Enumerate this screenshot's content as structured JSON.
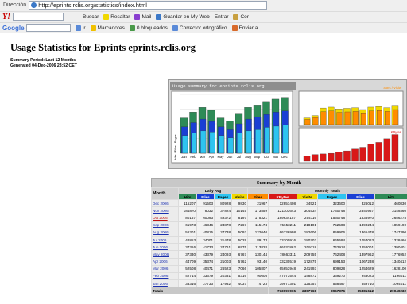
{
  "browser": {
    "address_label": "Dirección",
    "url": "http://eprints.rclis.org/statistics/index.html",
    "yahoo_logo": "Y!",
    "toolbar_items": [
      "Buscar",
      "Resaltar",
      "Mail",
      "Guardar en My Web",
      "Entrar",
      "Cor"
    ],
    "google_logo": "Google",
    "google_items": [
      "Ir",
      "Marcadores",
      "0 bloqueados",
      "Corrector ortográfico",
      "Enviar a"
    ]
  },
  "page": {
    "title": "Usage Statistics for Eprints eprints.rclis.org",
    "summary_period": "Summary Period: Last 12 Months",
    "generated": "Generated 04-Dec-2006 23:52 CET"
  },
  "chart_data": {
    "type": "bar",
    "title": "Usage summary for eprints.rclis.org",
    "right_legend": [
      "Sites",
      "Visits",
      "KBytes"
    ],
    "categories": [
      "Jan",
      "Feb",
      "Mar",
      "Apr",
      "May",
      "Jun",
      "Jul",
      "Aug",
      "Sep",
      "Oct",
      "Nov",
      "Dec"
    ],
    "series": [
      {
        "name": "Hits",
        "values": [
          60,
          70,
          78,
          73,
          60,
          55,
          68,
          78,
          82,
          88,
          92,
          95
        ]
      },
      {
        "name": "Files",
        "values": [
          45,
          52,
          58,
          54,
          45,
          40,
          50,
          58,
          62,
          66,
          70,
          72
        ]
      },
      {
        "name": "Pages",
        "values": [
          30,
          34,
          38,
          36,
          30,
          26,
          34,
          38,
          40,
          44,
          46,
          48
        ]
      },
      {
        "name": "Visits",
        "values": [
          22,
          30,
          55,
          58,
          52,
          54,
          56,
          50,
          58,
          60,
          56,
          64
        ]
      },
      {
        "name": "KBytes",
        "values": [
          18,
          22,
          24,
          26,
          30,
          34,
          40,
          46,
          56,
          62,
          74,
          88
        ]
      }
    ],
    "colors": {
      "hits": "#2e8b57",
      "files": "#1a3fd4",
      "pages": "#2ec4f0",
      "visits": "#f0d800",
      "sites": "#ff8c00",
      "kbytes": "#d81818",
      "panel_bg": "#ffffff",
      "title_bg": "#8e8e8e"
    }
  },
  "summary": {
    "title": "Summary by Month",
    "month_header": "Month",
    "group_headers": [
      "Daily Avg",
      "Monthly Totals"
    ],
    "columns": [
      "Hits",
      "Files",
      "Pages",
      "Visits",
      "Sites",
      "KBytes",
      "Visits",
      "Pages",
      "Files",
      "Hits"
    ],
    "column_colors": [
      "#2e8b57",
      "#1a3fd4",
      "#2ec4f0",
      "#f0d800",
      "#ff8c00",
      "#d81818",
      "#f0d800",
      "#2ec4f0",
      "#1a3fd4",
      "#2e8b57"
    ],
    "rows": [
      {
        "month": "Dec 2006",
        "cells": [
          "115207",
          "91503",
          "80928",
          "9830",
          "21967",
          "12851408",
          "34521",
          "323600",
          "326012",
          "460830"
        ]
      },
      {
        "month": "Nov 2006",
        "cells": [
          "184870",
          "78032",
          "37824",
          "10145",
          "173859",
          "121103643",
          "304534",
          "1740748",
          "2340967",
          "3149360"
        ]
      },
      {
        "month": "Oct 2006",
        "cells": [
          "80157",
          "60093",
          "49372",
          "8197",
          "175321",
          "189634157",
          "254116",
          "1530748",
          "1835970",
          "2656278"
        ]
      },
      {
        "month": "Sep 2006",
        "cells": [
          "61973",
          "46346",
          "24878",
          "7267",
          "115174",
          "75653211",
          "218101",
          "752508",
          "1390244",
          "1859190"
        ]
      },
      {
        "month": "Aug 2006",
        "cells": [
          "56301",
          "40815",
          "27738",
          "5093",
          "122040",
          "66736998",
          "182606",
          "859906",
          "1365478",
          "1747390"
        ]
      },
      {
        "month": "Jul 2006",
        "cells": [
          "42853",
          "34001",
          "21478",
          "5029",
          "89173",
          "33100916",
          "180703",
          "665594",
          "1054063",
          "1328466"
        ]
      },
      {
        "month": "Jun 2006",
        "cells": [
          "37316",
          "41733",
          "24761",
          "6975",
          "113828",
          "66037862",
          "209118",
          "742914",
          "1252001",
          "1390401"
        ]
      },
      {
        "month": "May 2006",
        "cells": [
          "37330",
          "43379",
          "24093",
          "6767",
          "130144",
          "78663311",
          "209755",
          "762408",
          "1397962",
          "1776952"
        ]
      },
      {
        "month": "Apr 2006",
        "cells": [
          "44709",
          "35374",
          "21003",
          "5762",
          "93140",
          "33230519",
          "172875",
          "699153",
          "1067238",
          "1340412"
        ]
      },
      {
        "month": "Mar 2006",
        "cells": [
          "52508",
          "40471",
          "26523",
          "7066",
          "105807",
          "65653948",
          "241993",
          "809828",
          "1254629",
          "1628100"
        ]
      },
      {
        "month": "Feb 2006",
        "cells": [
          "42714",
          "33679",
          "20331",
          "5316",
          "90605",
          "47073544",
          "148872",
          "369270",
          "943023",
          "1196011"
        ]
      },
      {
        "month": "Jan 2006",
        "cells": [
          "33316",
          "27733",
          "17932",
          "4037",
          "74723",
          "39977301",
          "125357",
          "558497",
          "859710",
          "1094011"
        ]
      }
    ],
    "totals_label": "Totals",
    "totals": [
      "733097065",
      "2307768",
      "8957376",
      "15381612",
      "20040232"
    ]
  }
}
